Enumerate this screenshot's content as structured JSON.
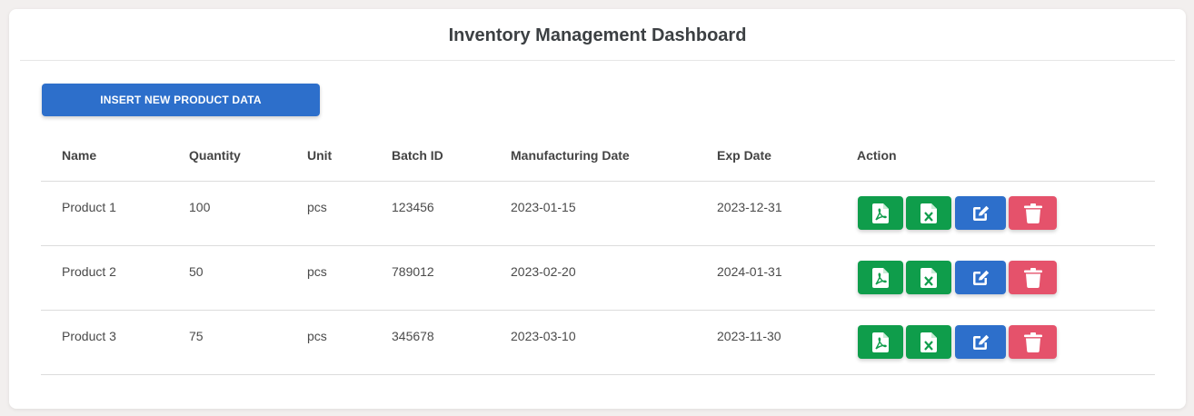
{
  "page_title": "Inventory Management Dashboard",
  "insert_button_label": "INSERT NEW PRODUCT DATA",
  "table": {
    "columns": [
      "Name",
      "Quantity",
      "Unit",
      "Batch ID",
      "Manufacturing Date",
      "Exp Date",
      "Action"
    ],
    "rows": [
      {
        "name": "Product 1",
        "quantity": "100",
        "unit": "pcs",
        "batch_id": "123456",
        "mfg_date": "2023-01-15",
        "exp_date": "2023-12-31"
      },
      {
        "name": "Product 2",
        "quantity": "50",
        "unit": "pcs",
        "batch_id": "789012",
        "mfg_date": "2023-02-20",
        "exp_date": "2024-01-31"
      },
      {
        "name": "Product 3",
        "quantity": "75",
        "unit": "pcs",
        "batch_id": "345678",
        "mfg_date": "2023-03-10",
        "exp_date": "2023-11-30"
      }
    ]
  },
  "action_icons": [
    "pdf-file-icon",
    "excel-file-icon",
    "edit-icon",
    "trash-icon"
  ],
  "colors": {
    "primary": "#2d6fcb",
    "success": "#0f9d4b",
    "danger": "#e5526b",
    "background": "#f2efee"
  }
}
